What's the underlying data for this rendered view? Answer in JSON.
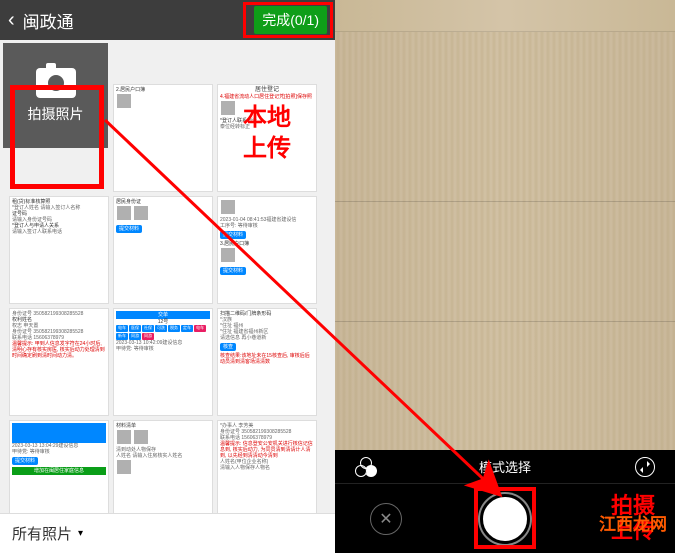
{
  "header": {
    "title": "闽政通",
    "complete_label": "完成(0/1)"
  },
  "camera_tile": {
    "label": "拍摄照片"
  },
  "annotations": {
    "local_upload_line1": "本地",
    "local_upload_line2": "上传",
    "shoot_line1": "拍摄",
    "shoot_line2": "上传"
  },
  "bottom_bar": {
    "all_photos": "所有照片"
  },
  "camera_controls": {
    "mode_label": "模式选择",
    "cancel": "✕"
  },
  "watermark": "江西龙网",
  "thumbnails": {
    "t1": {
      "line1": "2.居民户口簿",
      "btn": ""
    },
    "t2": {
      "header": "居住登记",
      "line1": "4.福建省流动人口居住登记凭[拍照]保存照",
      "line2": "*登订人联系电话",
      "small": "泰位经转标正"
    },
    "t3": {
      "l1": "租(贷)标准核算照",
      "l2": "*登订人姓名 请输入签订人名称",
      "l3": "证号码",
      "l4": "请输入身份证号码",
      "l5": "*登订人与申请人关系",
      "l6": "请输入签订人联系电话"
    },
    "t4": {
      "l1": "居民身份证",
      "btn": "提交材料"
    },
    "t5": {
      "l1": "2023-01-04 08:41:53福建省建设信",
      "l2": "工序号: 等待审核",
      "l3": "3.居民户口簿",
      "btn1": "提交材料",
      "btn2": "提交材料"
    },
    "t6": {
      "l1": "身份证号 350582199308285528",
      "l2": "权利姓名",
      "l3": "权志 申天置",
      "l4": "身份证号 350582199308285528",
      "l5": "联系电话 15606378979",
      "red": "温馨提示: 甲到人信息发字符在24小时后, 清明心存有核实房医, 核实后动力处理清到时间确定刷到清时间动力清。"
    },
    "t7": {
      "head": "交单",
      "sub": "12号",
      "tags": [
        "电车",
        "医保",
        "社保",
        "可洗",
        "税务",
        "定车",
        "电车",
        "新车",
        "同游",
        "同游",
        "同洗"
      ],
      "time": "2023-03-13 10:42:09建设信息",
      "status": "甲待党: 等待审核"
    },
    "t8": {
      "l1": "扫描二维码/门牌条形码",
      "l2": "*汉族",
      "l3": "*住址 福州",
      "l4": "*住址 福建省福州新区",
      "l5": "请选信息 再小巷道新",
      "btn": "核查",
      "red": "核查结果:该地址未在15核查后, 审核后后动员清到清客场清清数"
    },
    "t9": {
      "blue_area": "blue",
      "l1": "2023-03-13 13:04:29建设信息",
      "l2": "甲待党: 等待审核",
      "btn": "提交材料",
      "green": "增加在闽居住家庭信息"
    },
    "t10": {
      "l1": "材料清单",
      "l2": "清到动处人物保存",
      "l3": "人姓名 请输入住房核实人姓名"
    },
    "t11": {
      "l1": "*办事人 李芳美",
      "l2": "身份证号 350582199308285528",
      "l3": "联系电话 15606378979",
      "red": "温馨提示: 信息登安公安机关进行核信记信息到, 核实后动力, 为同员清到清请计人清到, 以先经到清清动今清到",
      "l4": "人姓名(甲位企业名称)",
      "l5": "清输入人物保存人物名"
    }
  }
}
